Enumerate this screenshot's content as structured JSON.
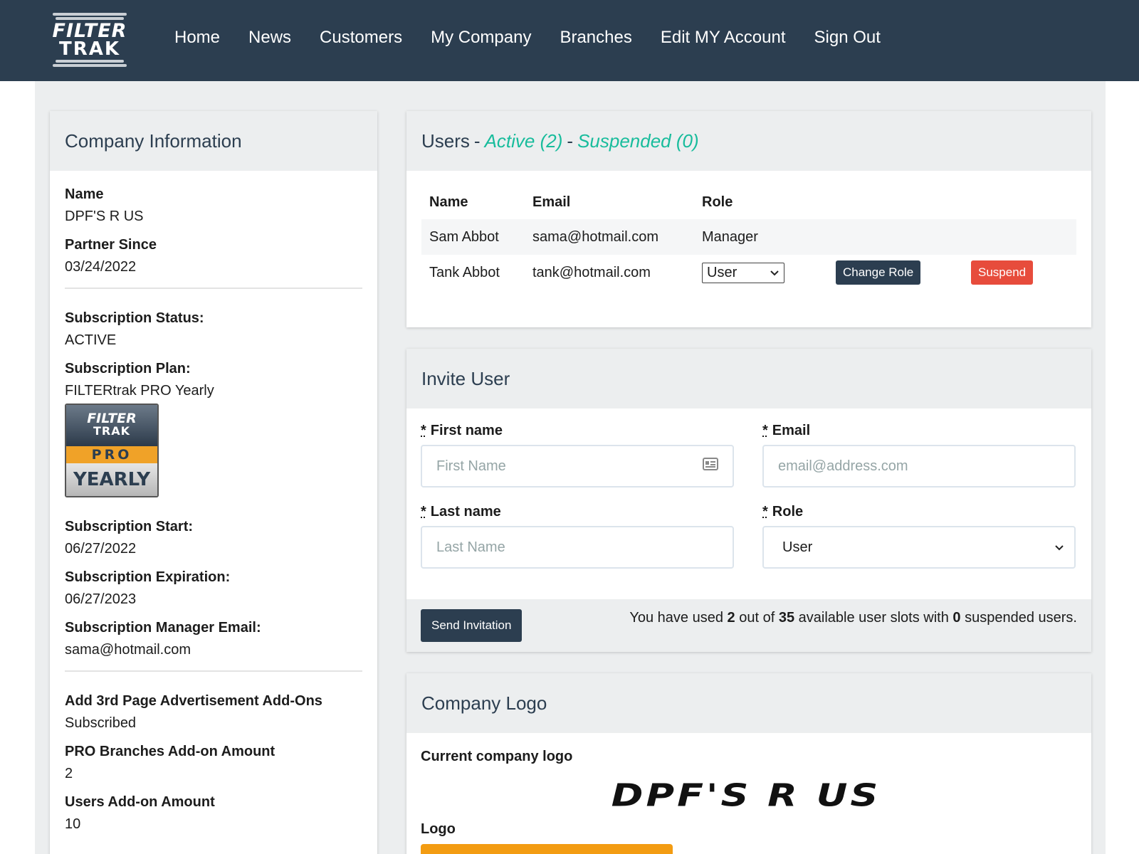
{
  "brand": {
    "line1": "FILTER",
    "line2": "TRAK"
  },
  "nav": [
    "Home",
    "News",
    "Customers",
    "My Company",
    "Branches",
    "Edit MY Account",
    "Sign Out"
  ],
  "company_info": {
    "title": "Company Information",
    "name_label": "Name",
    "name_value": "DPF'S R US",
    "partner_label": "Partner Since",
    "partner_value": "03/24/2022",
    "status_label": "Subscription Status:",
    "status_value": "ACTIVE",
    "plan_label": "Subscription Plan:",
    "plan_value": "FILTERtrak PRO Yearly",
    "badge": {
      "line1": "FILTER",
      "line2": "TRAK",
      "tier": "PRO",
      "period": "YEARLY"
    },
    "start_label": "Subscription Start:",
    "start_value": "06/27/2022",
    "expiration_label": "Subscription Expiration:",
    "expiration_value": "06/27/2023",
    "manager_label": "Subscription Manager Email:",
    "manager_value": "sama@hotmail.com",
    "addon_ads_label": "Add 3rd Page Advertisement Add-Ons",
    "addon_ads_value": "Subscribed",
    "branches_addon_label": "PRO Branches Add-on Amount",
    "branches_addon_value": "2",
    "users_addon_label": "Users Add-on Amount",
    "users_addon_value": "10"
  },
  "users": {
    "title": "Users",
    "sep": "-",
    "active_link": "Active (2)",
    "suspended_link": "Suspended (0)",
    "columns": [
      "Name",
      "Email",
      "Role"
    ],
    "rows": [
      {
        "name": "Sam Abbot",
        "email": "sama@hotmail.com",
        "role": "Manager"
      },
      {
        "name": "Tank Abbot",
        "email": "tank@hotmail.com",
        "role": "User"
      }
    ],
    "change_role_label": "Change Role",
    "suspend_label": "Suspend"
  },
  "invite": {
    "title": "Invite User",
    "required_mark": "*",
    "first_label": "First name",
    "first_placeholder": "First Name",
    "email_label": "Email",
    "email_placeholder": "email@address.com",
    "last_label": "Last name",
    "last_placeholder": "Last Name",
    "role_label": "Role",
    "role_value": "User",
    "send_label": "Send Invitation",
    "usage": {
      "pre": "You have used",
      "used": "2",
      "mid": "out of",
      "total": "35",
      "mid2": "available user slots with",
      "suspended": "0",
      "post": "suspended users."
    }
  },
  "company_logo": {
    "title": "Company Logo",
    "current_label": "Current company logo",
    "logo_text": "DPF'S R US",
    "logo_label": "Logo"
  },
  "colors": {
    "navbar": "#2c3e50",
    "accent_green": "#18bc9c",
    "danger": "#e74c3c",
    "upload_orange": "#f39c12"
  }
}
